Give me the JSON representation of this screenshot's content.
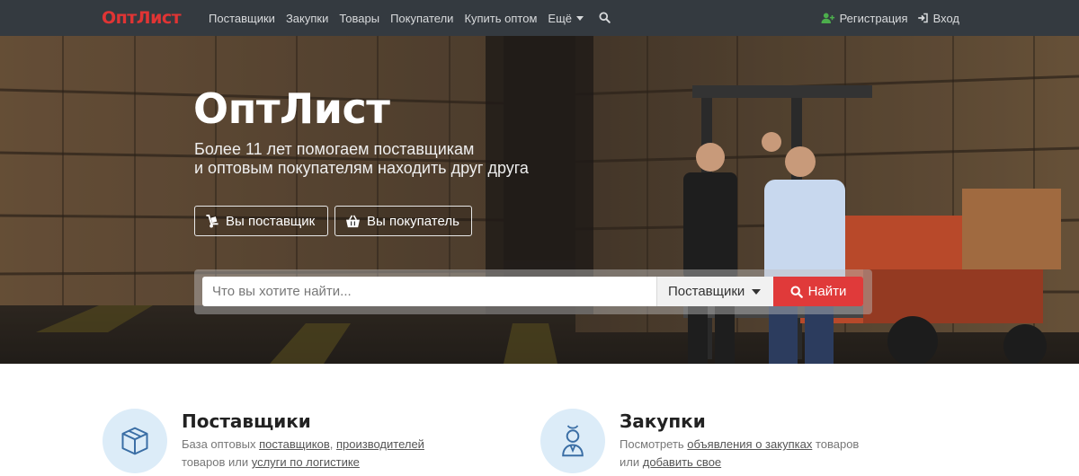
{
  "nav": {
    "brand": "ОптЛист",
    "links": [
      "Поставщики",
      "Закупки",
      "Товары",
      "Покупатели",
      "Купить оптом"
    ],
    "more": "Ещё",
    "register": "Регистрация",
    "login": "Вход"
  },
  "hero": {
    "title": "ОптЛист",
    "subtitle_line1": "Более 11 лет помогаем поставщикам",
    "subtitle_line2": "и оптовым покупателям находить друг друга",
    "btn_supplier": "Вы поставщик",
    "btn_buyer": "Вы покупатель"
  },
  "search": {
    "placeholder": "Что вы хотите найти...",
    "category": "Поставщики",
    "button": "Найти"
  },
  "features": {
    "suppliers": {
      "title": "Поставщики",
      "text1": "База оптовых ",
      "link1": "поставщиков",
      "sep": ", ",
      "link2": "производителей",
      "text2": "товаров или ",
      "link3": "услуги по логистике"
    },
    "purchases": {
      "title": "Закупки",
      "text1": "Посмотреть ",
      "link1": "объявления о закупках",
      "text2": " товаров",
      "text3": "или ",
      "link2": "добавить свое"
    }
  },
  "colors": {
    "navbar": "#343a40",
    "brand": "#e03434",
    "accent": "#e03a3a",
    "icon_circle": "#dcecf8"
  }
}
